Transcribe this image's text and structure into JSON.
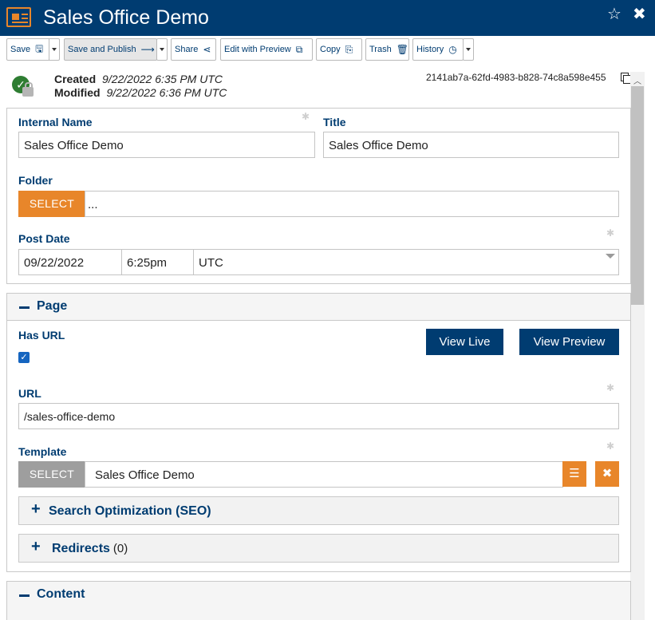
{
  "window": {
    "title": "Sales Office Demo"
  },
  "toolbar": {
    "save": "Save",
    "save_publish": "Save and Publish",
    "share": "Share",
    "edit_preview": "Edit with Preview",
    "copy": "Copy",
    "trash": "Trash",
    "history": "History"
  },
  "meta": {
    "created_label": "Created",
    "created_value": "9/22/2022 6:35 PM UTC",
    "modified_label": "Modified",
    "modified_value": "9/22/2022 6:36 PM UTC",
    "guid": "2141ab7a-62fd-4983-b828-74c8a598e455"
  },
  "fields": {
    "internal_name_label": "Internal Name",
    "internal_name_value": "Sales Office Demo",
    "title_label": "Title",
    "title_value": "Sales Office Demo",
    "folder_label": "Folder",
    "folder_select": "SELECT",
    "folder_value": "...",
    "post_date_label": "Post Date",
    "post_date_value": "09/22/2022",
    "post_time_value": "6:25pm",
    "timezone_value": "UTC"
  },
  "page_section": {
    "title": "Page",
    "has_url_label": "Has URL",
    "has_url_checked": true,
    "view_live": "View Live",
    "view_preview": "View Preview",
    "url_label": "URL",
    "url_value": "/sales-office-demo",
    "template_label": "Template",
    "template_select": "SELECT",
    "template_value": "Sales Office Demo",
    "seo_title": "Search Optimization (SEO)",
    "redirects_title": "Redirects",
    "redirects_count": "(0)"
  },
  "content_section": {
    "title": "Content"
  },
  "colors": {
    "header": "#003c71",
    "accent": "#e8862a",
    "primary": "#003c71"
  },
  "icons": [
    "newspaper-icon",
    "star-icon",
    "close-icon",
    "save-icon",
    "arrow-right-icon",
    "share-icon",
    "external-link-icon",
    "copy-icon",
    "trash-icon",
    "clock-icon",
    "check-circle-icon",
    "lock-icon",
    "hamburger-icon",
    "x-icon"
  ]
}
